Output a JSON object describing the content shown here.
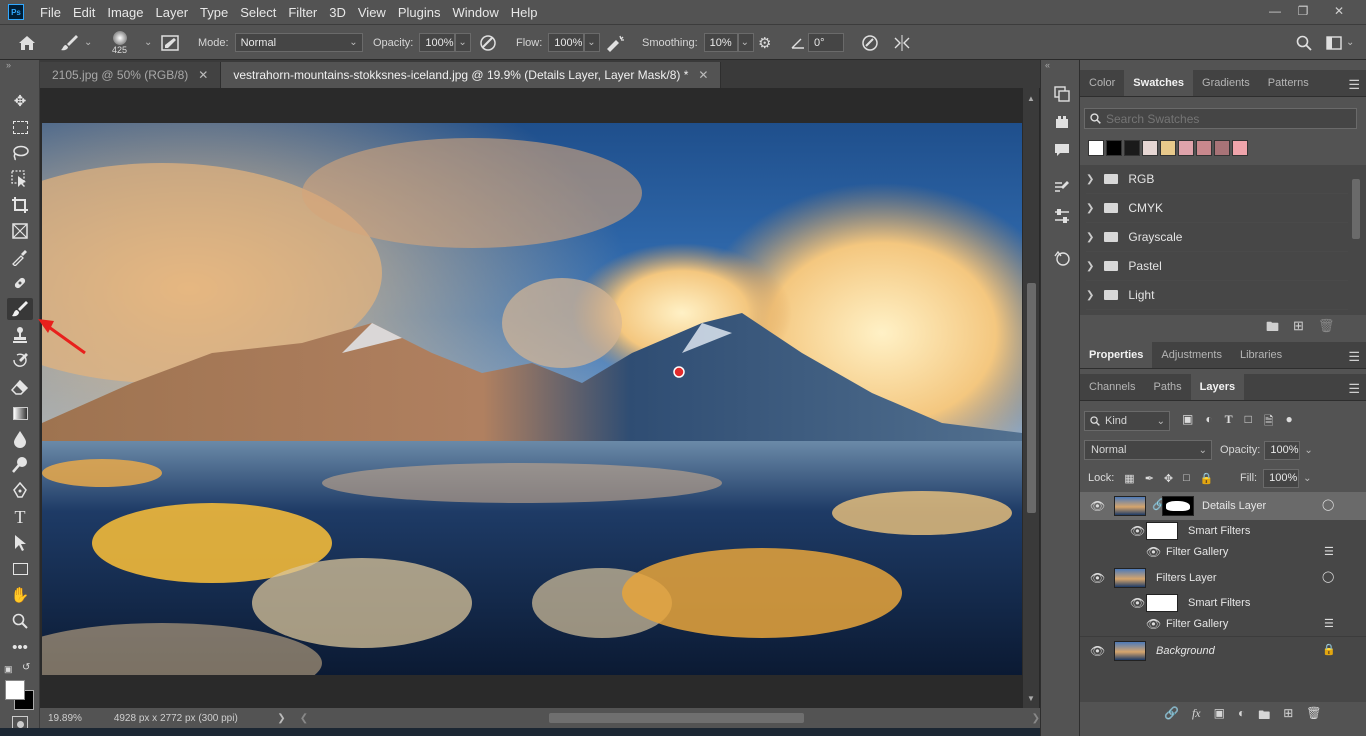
{
  "menu": {
    "items": [
      "File",
      "Edit",
      "Image",
      "Layer",
      "Type",
      "Select",
      "Filter",
      "3D",
      "View",
      "Plugins",
      "Window",
      "Help"
    ],
    "logo": "Ps"
  },
  "options": {
    "brush_size": "425",
    "mode_label": "Mode:",
    "mode_value": "Normal",
    "opacity_label": "Opacity:",
    "opacity_value": "100%",
    "flow_label": "Flow:",
    "flow_value": "100%",
    "smoothing_label": "Smoothing:",
    "smoothing_value": "10%",
    "angle_value": "0°"
  },
  "tabs": [
    {
      "label": "2105.jpg @ 50% (RGB/8)"
    },
    {
      "label": "vestrahorn-mountains-stokksnes-iceland.jpg @ 19.9% (Details Layer, Layer Mask/8) *"
    }
  ],
  "status": {
    "zoom": "19.89%",
    "doc_info": "4928 px x 2772 px (300 ppi)"
  },
  "swatches_panel": {
    "tabs": [
      "Color",
      "Swatches",
      "Gradients",
      "Patterns"
    ],
    "search_placeholder": "Search Swatches",
    "colors": [
      "#ffffff",
      "#000000",
      "#1a1a1a",
      "#e6d6d3",
      "#e8c98b",
      "#dfa3ab",
      "#c8888d",
      "#a87377",
      "#efa4ab"
    ],
    "folders": [
      "RGB",
      "CMYK",
      "Grayscale",
      "Pastel",
      "Light"
    ]
  },
  "properties_panel": {
    "tabs": [
      "Properties",
      "Adjustments",
      "Libraries"
    ]
  },
  "layers_panel": {
    "tabs": [
      "Channels",
      "Paths",
      "Layers"
    ],
    "kind_label": "Kind",
    "blend_mode": "Normal",
    "opacity_label": "Opacity:",
    "opacity_value": "100%",
    "lock_label": "Lock:",
    "fill_label": "Fill:",
    "fill_value": "100%",
    "layers": [
      {
        "name": "Details Layer",
        "smart_filters": "Smart Filters",
        "filter": "Filter Gallery"
      },
      {
        "name": "Filters Layer",
        "smart_filters": "Smart Filters",
        "filter": "Filter Gallery"
      },
      {
        "name": "Background"
      }
    ]
  },
  "accent": "#31a8ff",
  "arrow_color": "#e8201c"
}
